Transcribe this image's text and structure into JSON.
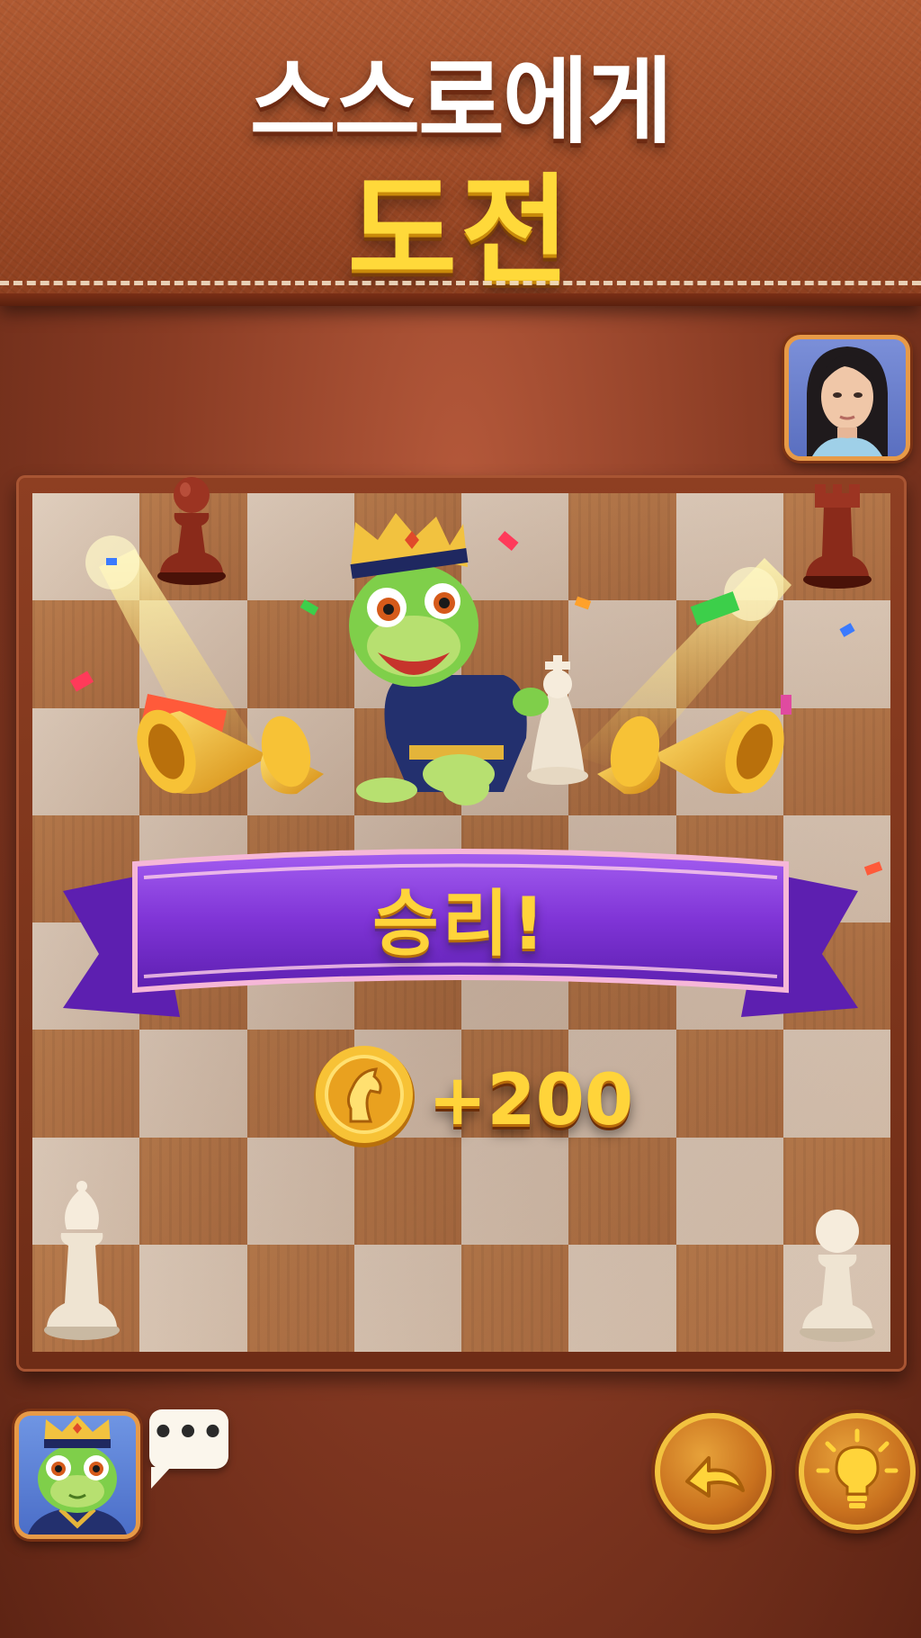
{
  "header": {
    "title_line1": "스스로에게",
    "title_line2": "도전"
  },
  "victory": {
    "label": "승리!",
    "reward_icon": "horse-coin-icon",
    "reward_amount": "+200"
  },
  "chat": {
    "text": "•••"
  },
  "controls": {
    "undo_icon": "undo-arrow-icon",
    "hint_icon": "lightbulb-icon"
  },
  "colors": {
    "title_white": "#ffffff",
    "title_gold": "#ffd93a",
    "ribbon_purple": "#8a3ddb",
    "board_light": "#f2e3d2",
    "board_dark": "#c98a57",
    "button_gold": "#f2c23f"
  }
}
